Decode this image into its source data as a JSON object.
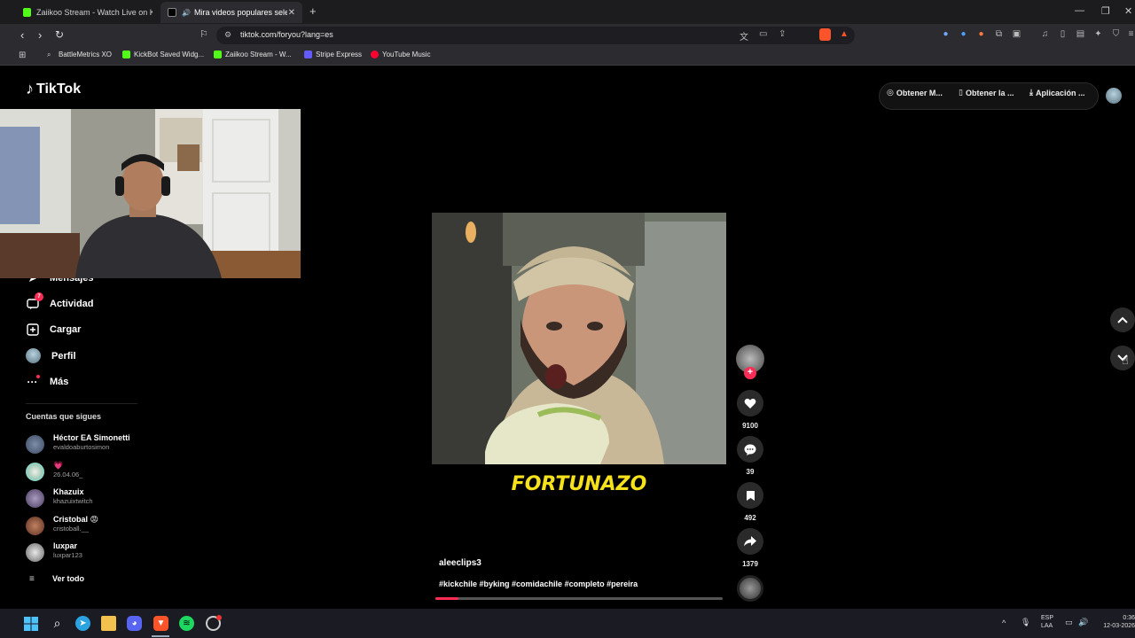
{
  "browser": {
    "tabs": [
      {
        "label": "Zaiikoo Stream - Watch Live on Kick",
        "active": false
      },
      {
        "label": "Mira videos populares selecci",
        "active": true
      }
    ],
    "url": "tiktok.com/foryou?lang=es",
    "bookmarks": [
      {
        "label": "BattleMetrics XO",
        "color": "#888888"
      },
      {
        "label": "KickBot Saved Widg...",
        "color": "#53fc18"
      },
      {
        "label": "Zaiikoo Stream - W...",
        "color": "#53fc18"
      },
      {
        "label": "Stripe Express",
        "color": "#635bff"
      },
      {
        "label": "YouTube Music",
        "color": "#ff0033"
      }
    ]
  },
  "tiktok": {
    "logo": "TikTok",
    "top_buttons": [
      "Obtener M...",
      "Obtener la ...",
      "Aplicación ..."
    ],
    "nav": [
      {
        "label": "Mensajes",
        "icon": "send-icon"
      },
      {
        "label": "Actividad",
        "icon": "inbox-icon",
        "badge": "7"
      },
      {
        "label": "Cargar",
        "icon": "upload-icon"
      },
      {
        "label": "Perfil",
        "icon": "avatar-icon"
      },
      {
        "label": "Más",
        "icon": "more-icon"
      }
    ],
    "following_title": "Cuentas que sigues",
    "accounts": [
      {
        "name": "Héctor EA Simonetti",
        "user": "evaldoaburtosimon"
      },
      {
        "name": "💗",
        "user": "26.04.06_"
      },
      {
        "name": "Khazuix",
        "user": "khazuixtwitch"
      },
      {
        "name": "Cristobal 😡",
        "user": "cristoball.__"
      },
      {
        "name": "luxpar",
        "user": "luxpar123"
      }
    ],
    "see_all": "Ver todo",
    "video": {
      "overlay_text": "FORTUNAZO",
      "author": "aleeclips3",
      "hashtags": "#kickchile #byking #comidachile #completo #pereira",
      "progress": 0.08
    },
    "actions": {
      "likes": "9100",
      "comments": "39",
      "saves": "492",
      "shares": "1379"
    }
  },
  "taskbar": {
    "lang": "ESP",
    "lang2": "LAA",
    "time": "0:36",
    "date": "12-03-2026"
  },
  "colors": {
    "accent": "#fe2c55",
    "overlay_text": "#f5e21a"
  }
}
